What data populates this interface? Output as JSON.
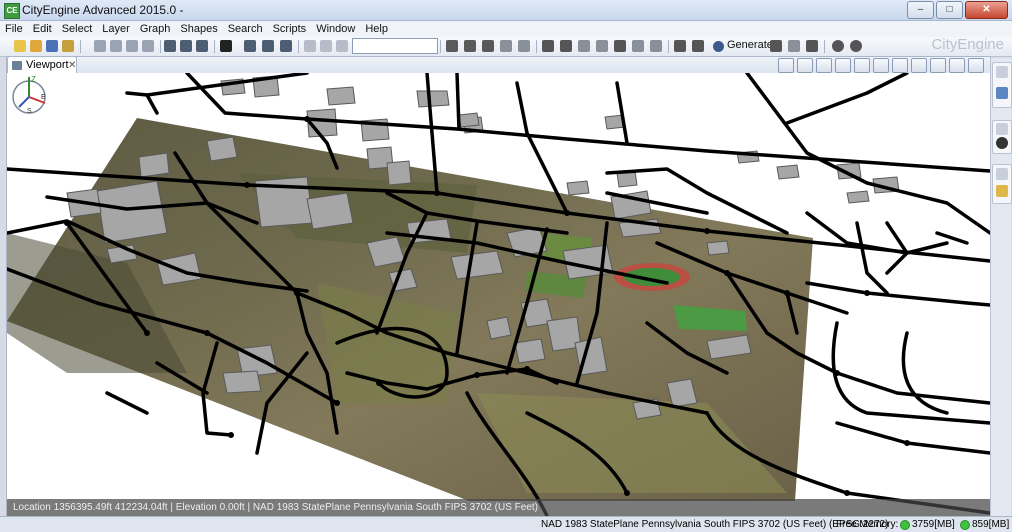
{
  "window": {
    "title": "CityEngine Advanced 2015.0 -",
    "app_icon": "cityengine-icon"
  },
  "menu": [
    "File",
    "Edit",
    "Select",
    "Layer",
    "Graph",
    "Shapes",
    "Search",
    "Scripts",
    "Window",
    "Help"
  ],
  "toolbar": {
    "search_value": "",
    "generate_label": "Generate",
    "brand": "CityEngine"
  },
  "tab": {
    "label": "Viewport"
  },
  "viewport": {
    "location_text": "Location 1356395.49ft 412234.04ft  |  Elevation 0.00ft  |  NAD 1983 StatePlane Pennsylvania South FIPS 3702 (US Feet)"
  },
  "compass": {
    "labels": [
      "Z",
      "E",
      "S"
    ]
  },
  "statusbar": {
    "coords": "NAD 1983 StatePlane Pennsylvania South FIPS 3702 (US Feet) (EPSG:2272)",
    "free_memory_label": "Free Memory:",
    "mem1": "3759[MB]",
    "mem2": "859[MB]"
  },
  "colors": {
    "street": "#000000",
    "building": "#a6a6a6",
    "terrain": "#7c7350",
    "status_ok": "#3fc23f"
  }
}
